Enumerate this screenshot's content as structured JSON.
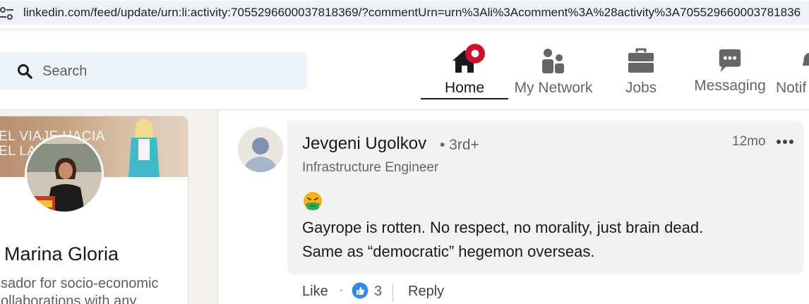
{
  "browser": {
    "url": "linkedin.com/feed/update/urn:li:activity:7055296600037818369/?commentUrn=urn%3Ali%3Acomment%3A%28activity%3A705529660003781836"
  },
  "header": {
    "search_placeholder": "Search",
    "nav": [
      {
        "label": "Home",
        "icon": "home-icon",
        "active": true,
        "badge": true
      },
      {
        "label": "My Network",
        "icon": "my-network-icon"
      },
      {
        "label": "Jobs",
        "icon": "briefcase-icon"
      },
      {
        "label": "Messaging",
        "icon": "messaging-icon"
      },
      {
        "label": "Notif",
        "icon": "bell-icon"
      }
    ]
  },
  "profile_card": {
    "banner_text": "EL VIAJE HACIA\nEL LADO D",
    "name": "Marina Gloria",
    "headline": "ssador for socio-economic\ncollaborations with any"
  },
  "comment": {
    "author": "Jevgeni Ugolkov",
    "degree": "• 3rd+",
    "subtitle": "Infrastructure Engineer",
    "time": "12mo",
    "emoji": "sick-face-emoji",
    "text_line1": "Gayrope is rotten. No respect, no morality, just brain dead.",
    "text_line2": "Same as “democratic” hegemon overseas.",
    "actions": {
      "like_label": "Like",
      "separator": "·",
      "reaction_count": "3",
      "reply_label": "Reply"
    }
  },
  "colors": {
    "active_nav": "#191919",
    "badge": "#cb112d",
    "like_blue": "#378fe9",
    "feed_bg": "#f4f2ee"
  }
}
